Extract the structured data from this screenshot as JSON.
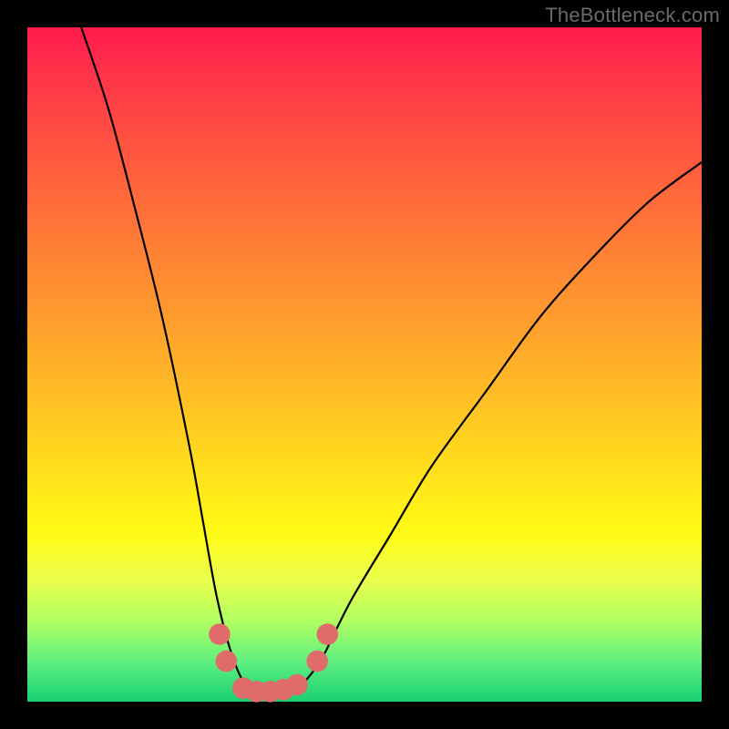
{
  "watermark": "TheBottleneck.com",
  "chart_data": {
    "type": "line",
    "title": "",
    "xlabel": "",
    "ylabel": "",
    "xlim": [
      0,
      100
    ],
    "ylim": [
      0,
      100
    ],
    "grid": false,
    "legend": false,
    "annotations": [],
    "series": [
      {
        "name": "bottleneck-curve",
        "x": [
          8,
          12,
          16,
          20,
          24,
          26,
          28,
          30,
          32,
          34,
          36,
          38,
          40,
          42,
          44,
          48,
          54,
          60,
          68,
          76,
          84,
          92,
          100
        ],
        "y": [
          100,
          88,
          73,
          57,
          38,
          27,
          16,
          8,
          3,
          1,
          1,
          1,
          2,
          4,
          7,
          15,
          25,
          35,
          46,
          57,
          66,
          74,
          80
        ]
      }
    ],
    "markers": [
      {
        "name": "marker-left-upper",
        "x": 28.5,
        "y": 10,
        "r": 1.6
      },
      {
        "name": "marker-left-lower",
        "x": 29.5,
        "y": 6,
        "r": 1.6
      },
      {
        "name": "marker-bottom-1",
        "x": 32,
        "y": 2,
        "r": 1.6
      },
      {
        "name": "marker-bottom-2",
        "x": 34,
        "y": 1.5,
        "r": 1.6
      },
      {
        "name": "marker-bottom-3",
        "x": 36,
        "y": 1.5,
        "r": 1.6
      },
      {
        "name": "marker-bottom-4",
        "x": 38,
        "y": 1.8,
        "r": 1.6
      },
      {
        "name": "marker-bottom-5",
        "x": 40,
        "y": 2.5,
        "r": 1.6
      },
      {
        "name": "marker-right-lower",
        "x": 43,
        "y": 6,
        "r": 1.6
      },
      {
        "name": "marker-right-upper",
        "x": 44.5,
        "y": 10,
        "r": 1.6
      }
    ],
    "colors": {
      "curve": "#000000",
      "marker": "#e06b6b",
      "gradient_top": "#ff1a4d",
      "gradient_bottom": "#18d070"
    }
  }
}
